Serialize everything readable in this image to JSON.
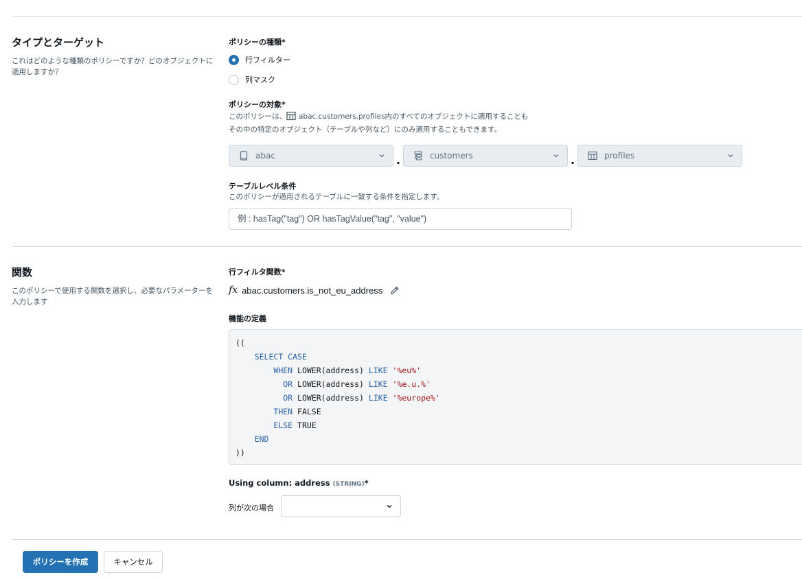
{
  "type_target": {
    "title": "タイプとターゲット",
    "description": "これはどのような種類のポリシーですか？どのオブジェクトに適用しますか？",
    "policy_type_label": "ポリシーの種類*",
    "policy_types": [
      {
        "label": "行フィルター",
        "checked": true
      },
      {
        "label": "列マスク",
        "checked": false
      }
    ],
    "target_label": "ポリシーの対象*",
    "target_help_prefix": "このポリシーは、",
    "target_help_object": "abac.customers.profiles",
    "target_help_suffix": "内のすべてのオブジェクトに適用することも",
    "target_help_line2": "その中の特定のオブジェクト（テーブルや列など）にのみ適用することもできます。",
    "selectors": [
      {
        "value": "abac",
        "icon": "catalog-icon"
      },
      {
        "value": "customers",
        "icon": "schema-icon"
      },
      {
        "value": "profiles",
        "icon": "table-icon"
      }
    ],
    "separator": ".",
    "table_condition_label": "テーブルレベル条件",
    "table_condition_help": "このポリシーが適用されるテーブルに一致する条件を指定します。",
    "table_condition_placeholder": "例 : hasTag(\"tag\") OR hasTagValue(\"tag\", \"value\")"
  },
  "functions": {
    "title": "関数",
    "description": "このポリシーで使用する関数を選択し、必要なパラメーターを入力します",
    "row_filter_label": "行フィルタ関数*",
    "fx_symbol": "fx",
    "function_name": "abac.customers.is_not_eu_address",
    "definition_label": "機能の定義",
    "code_lines": [
      [
        {
          "t": "(("
        }
      ],
      [
        {
          "t": "    "
        },
        {
          "t": "SELECT CASE",
          "c": "kw"
        }
      ],
      [
        {
          "t": "        "
        },
        {
          "t": "WHEN",
          "c": "kw"
        },
        {
          "t": " LOWER(address) "
        },
        {
          "t": "LIKE",
          "c": "kw"
        },
        {
          "t": " "
        },
        {
          "t": "'%eu%'",
          "c": "str"
        }
      ],
      [
        {
          "t": "          "
        },
        {
          "t": "OR",
          "c": "kw"
        },
        {
          "t": " LOWER(address) "
        },
        {
          "t": "LIKE",
          "c": "kw"
        },
        {
          "t": " "
        },
        {
          "t": "'%e.u.%'",
          "c": "str"
        }
      ],
      [
        {
          "t": "          "
        },
        {
          "t": "OR",
          "c": "kw"
        },
        {
          "t": " LOWER(address) "
        },
        {
          "t": "LIKE",
          "c": "kw"
        },
        {
          "t": " "
        },
        {
          "t": "'%europe%'",
          "c": "str"
        }
      ],
      [
        {
          "t": "        "
        },
        {
          "t": "THEN",
          "c": "kw"
        },
        {
          "t": " FALSE"
        }
      ],
      [
        {
          "t": "        "
        },
        {
          "t": "ELSE",
          "c": "kw"
        },
        {
          "t": " TRUE"
        }
      ],
      [
        {
          "t": "    "
        },
        {
          "t": "END",
          "c": "kw"
        }
      ],
      [
        {
          "t": "))"
        }
      ]
    ],
    "using_column_label": "Using column: address",
    "using_column_type": "(STRING)",
    "using_column_required": "*",
    "column_condition_label": "列が次の場合",
    "column_condition_value": ""
  },
  "footer": {
    "create_label": "ポリシーを作成",
    "cancel_label": "キャンセル"
  },
  "colors": {
    "primary": "#2272b4",
    "keyword": "#2a63a6",
    "string": "#a31515"
  }
}
